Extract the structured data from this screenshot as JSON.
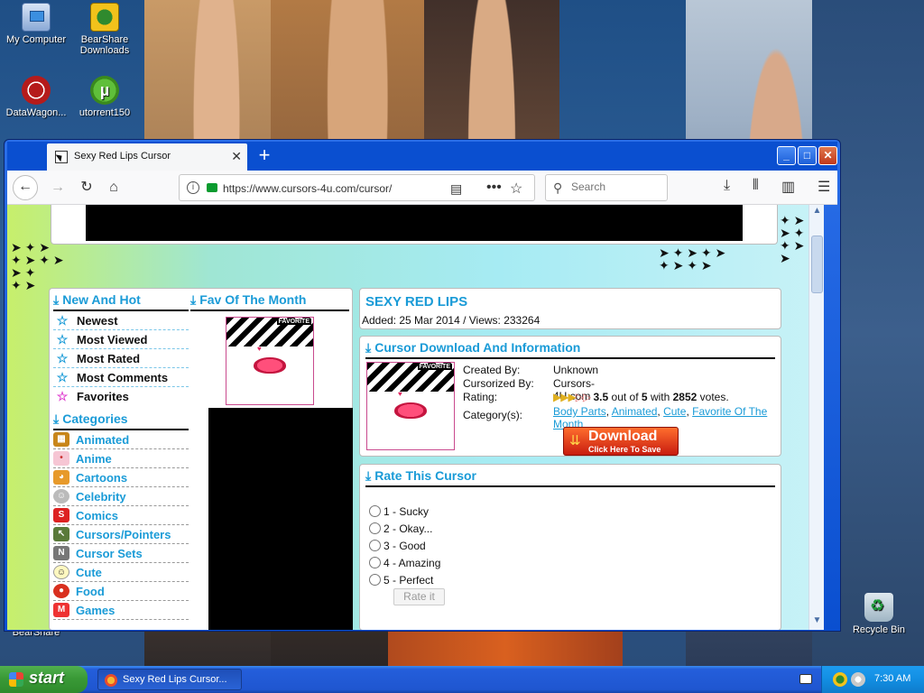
{
  "desktop": {
    "icons": [
      {
        "label": "My Computer",
        "icon": "computer-icon"
      },
      {
        "label": "BearShare Downloads",
        "icon": "bearshare-icon"
      },
      {
        "label": "DataWagon...",
        "icon": "datawagon-icon"
      },
      {
        "label": "utorrent150",
        "icon": "utorrent-icon"
      },
      {
        "label": "Recycle Bin",
        "icon": "recycle-bin-icon"
      },
      {
        "label": "BearShare",
        "icon": "bearshare-icon"
      }
    ]
  },
  "browser": {
    "tab_title": "Sexy Red Lips Cursor",
    "url": "https://www.cursors-4u.com/cursor/",
    "search_placeholder": "Search",
    "window_buttons": {
      "minimize": "_",
      "maximize": "□",
      "close": "✕"
    }
  },
  "page": {
    "new_and_hot": {
      "title": "New And Hot",
      "items": [
        "Newest",
        "Most Viewed",
        "Most Rated",
        "Most Comments",
        "Favorites"
      ]
    },
    "fav_of_month": {
      "title": "Fav Of The Month",
      "badge": "FAVORITE"
    },
    "categories": {
      "title": "Categories",
      "items": [
        "Animated",
        "Anime",
        "Cartoons",
        "Celebrity",
        "Comics",
        "Cursors/Pointers",
        "Cursor Sets",
        "Cute",
        "Food",
        "Games"
      ]
    },
    "cursor": {
      "name": "SEXY RED LIPS",
      "added": "Added: 25 Mar 2014 / Views: 233264"
    },
    "download_info": {
      "title": "Cursor Download And Information",
      "badge": "FAVORITE",
      "created_by_label": "Created By:",
      "created_by": "Unknown",
      "cursorized_by_label": "Cursorized By:",
      "cursorized_by": "Cursors-4U.com",
      "rating_label": "Rating:",
      "rating_value": "3.5",
      "rating_out_of": "out of",
      "rating_max": "5",
      "rating_with": "with",
      "rating_votes": "2852",
      "rating_votes_suffix": "votes.",
      "categories_label": "Category(s):",
      "categories": [
        "Body Parts",
        "Animated",
        "Cute",
        "Favorite Of The Month"
      ],
      "download_label": "Download",
      "download_sub": "Click Here To Save"
    },
    "rate": {
      "title": "Rate This Cursor",
      "options": [
        "1 - Sucky",
        "2 - Okay...",
        "3 - Good",
        "4 - Amazing",
        "5 - Perfect"
      ],
      "button": "Rate it"
    }
  },
  "taskbar": {
    "start_label": "start",
    "task_item": "Sexy Red Lips Cursor...",
    "clock": "7:30 AM"
  }
}
